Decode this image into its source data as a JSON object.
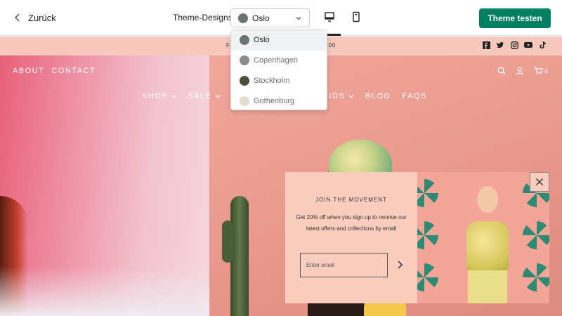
{
  "topbar": {
    "back_label": "Zurück",
    "theme_label": "Theme-Designs",
    "selected_theme": "Oslo",
    "selected_color": "#6b7470",
    "cta_label": "Theme testen",
    "cta_color": "#008060"
  },
  "dropdown": {
    "options": [
      {
        "label": "Oslo",
        "color": "#6b7470"
      },
      {
        "label": "Copenhagen",
        "color": "#8a8c8e"
      },
      {
        "label": "Stockholm",
        "color": "#4a4f3f"
      },
      {
        "label": "Gothenburg",
        "color": "#e6dccd"
      }
    ]
  },
  "store": {
    "announce_left": "FI",
    "announce_right": "100",
    "nav_left": [
      "ABOUT",
      "CONTACT"
    ],
    "menu": [
      "SHOP",
      "SALE",
      "T",
      "IDS",
      "BLOG",
      "FAQS"
    ],
    "cart_count": "0"
  },
  "popup": {
    "title": "JOIN THE MOVEMENT",
    "text": "Get 20% off when you sign up to receive our latest offers and collections by email",
    "email_placeholder": "Enter email"
  },
  "icons": [
    "chevron-left-icon",
    "chevron-down-icon",
    "desktop-icon",
    "mobile-icon",
    "facebook-icon",
    "twitter-icon",
    "instagram-icon",
    "youtube-icon",
    "tiktok-icon",
    "search-icon",
    "user-icon",
    "cart-icon",
    "arrow-right-icon",
    "close-icon"
  ]
}
